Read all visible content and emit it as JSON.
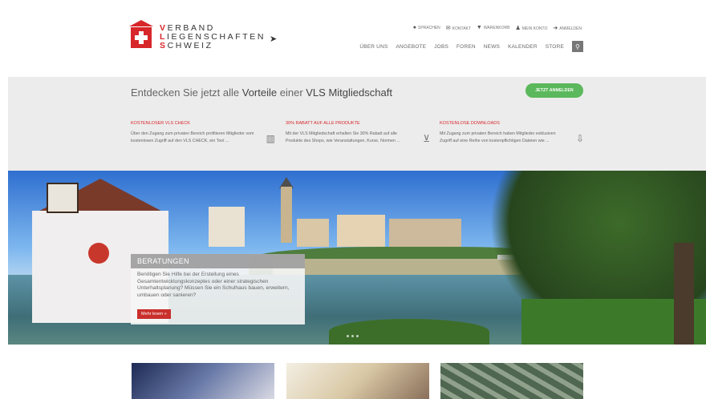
{
  "logo": {
    "lines": [
      {
        "cap": "V",
        "rest": "ERBAND"
      },
      {
        "cap": "L",
        "rest": "IEGENSCHAFTEN"
      },
      {
        "cap": "S",
        "rest": "CHWEIZ"
      }
    ]
  },
  "util_nav": [
    {
      "icon": "globe-icon",
      "label": "SPRACHEN"
    },
    {
      "icon": "envelope-icon",
      "label": "KONTAKT"
    },
    {
      "icon": "cart-icon",
      "label": "WARENKORB"
    },
    {
      "icon": "user-icon",
      "label": "MEIN KONTO"
    },
    {
      "icon": "sign-in-icon",
      "label": "ANMELDEN"
    }
  ],
  "main_nav": [
    "ÜBER UNS",
    "ANGEBOTE",
    "JOBS",
    "FOREN",
    "NEWS",
    "KALENDER",
    "STORE"
  ],
  "promo": {
    "title_pre": "Entdecken Sie jetzt alle ",
    "title_b1": "Vorteile",
    "title_mid": " einer ",
    "title_b2": "VLS Mitgliedschaft",
    "join_label": "JETZT ANMELDEN",
    "columns": [
      {
        "heading": "KOSTENLOSER VLS CHECK",
        "text": "Über den Zugang zum privaten Bereich profitieren Mitglieder vom kostenlosen Zugriff auf den VLS CHECK, ein Tool ...",
        "icon": "bar-chart-icon"
      },
      {
        "heading": "30% RABATT AUF ALLE PRODUKTE",
        "text": "Mit der VLS Mitgliedschaft erhalten Sie 30% Rabatt auf alle Produkte des Shops, wie Veranstaltungen, Kurse, Normen ...",
        "icon": "cart-icon"
      },
      {
        "heading": "KOSTENLOSE DOWNLOADS",
        "text": "Mit Zugang zum privaten Bereich haben Mitglieder exklusiven Zugriff auf eine Reihe von kostenpflichtigen Dateien wie ...",
        "icon": "download-icon"
      }
    ]
  },
  "hero": {
    "title": "BERATUNGEN",
    "text": "Benötigen Sie Hilfe bei der Erstellung eines Gesamtentwicklungskonzeptes oder einer strategischen Unterhaltsplanung? Müssen Sie ein Schulhaus bauen, erweitern, umbauen oder sanieren?",
    "button": "Mehr lesen »"
  },
  "colors": {
    "brand_red": "#d7262a",
    "button_green": "#5cb85c"
  }
}
